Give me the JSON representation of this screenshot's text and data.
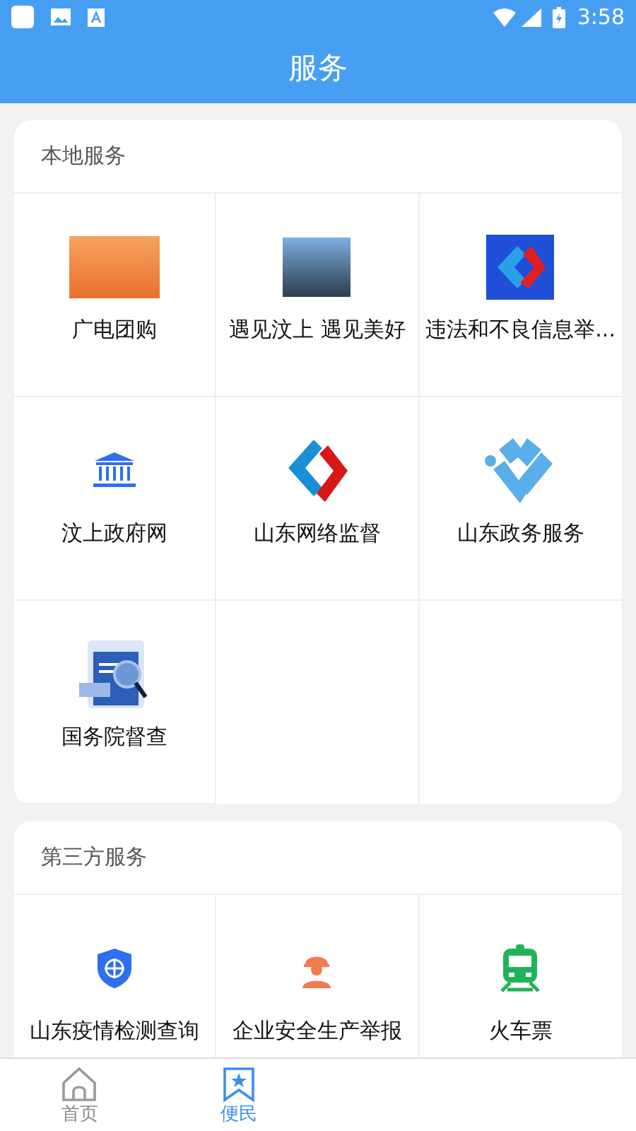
{
  "status_bar": {
    "time": "3:58"
  },
  "header": {
    "title": "服务"
  },
  "sections": [
    {
      "title": "本地服务",
      "items": [
        {
          "label": "广电团购"
        },
        {
          "label": "遇见汶上 遇见美好"
        },
        {
          "label": "违法和不良信息举..."
        },
        {
          "label": "汶上政府网"
        },
        {
          "label": "山东网络监督"
        },
        {
          "label": "山东政务服务"
        },
        {
          "label": "国务院督查"
        }
      ]
    },
    {
      "title": "第三方服务",
      "items": [
        {
          "label": "山东疫情检测查询"
        },
        {
          "label": "企业安全生产举报"
        },
        {
          "label": "火车票"
        }
      ]
    }
  ],
  "tab_bar": [
    {
      "label": "首页",
      "selected": false
    },
    {
      "label": "便民",
      "selected": true
    }
  ]
}
